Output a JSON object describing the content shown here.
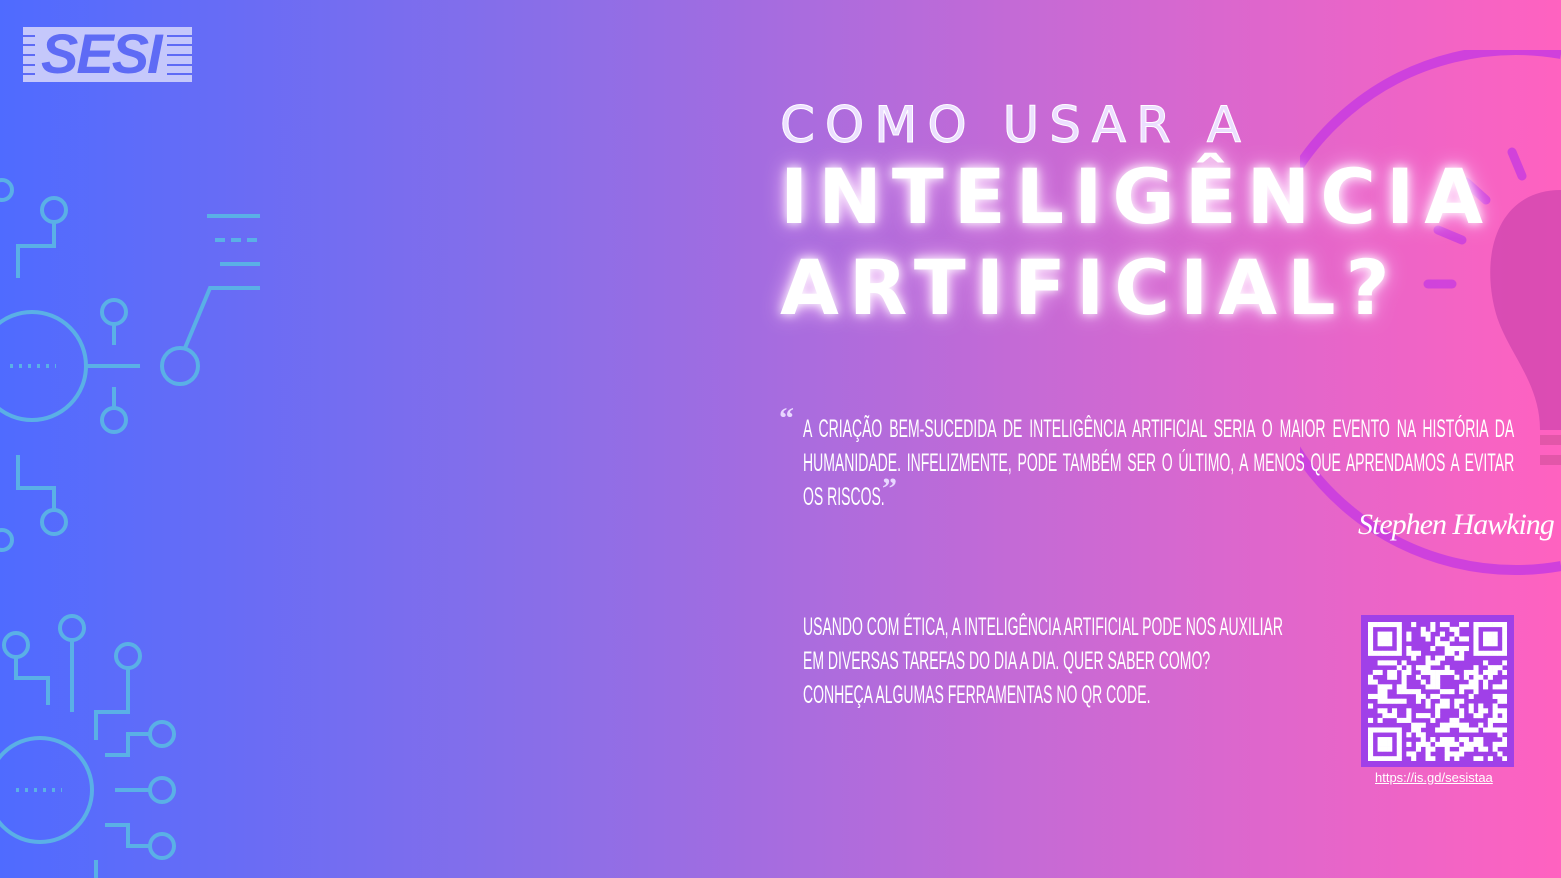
{
  "logo": {
    "text": "SESI"
  },
  "title": {
    "line1": "COMO USAR A",
    "line2": "INTELIGÊNCIA",
    "line3": "ARTIFICIAL?"
  },
  "quote": {
    "text": "A criação bem-sucedida de inteligência artificial seria o maior evento na história da humanidade. Infelizmente, pode também ser o último, a menos que aprendamos a evitar os riscos.",
    "open_mark": "“",
    "close_mark": "”",
    "author": "Stephen Hawking"
  },
  "body": {
    "lines": [
      "Usando com ética, a inteligência artificial pode nos auxiliar",
      "em diversas tarefas do dia a dia. Quer saber como?",
      "Conheça algumas ferramentas no QR code."
    ]
  },
  "qr": {
    "url": "https://is.gd/sesistaa"
  },
  "colors": {
    "circuit": "#5ab0e6",
    "qr_bg": "#a040e8",
    "bulb": "#c83be0"
  }
}
